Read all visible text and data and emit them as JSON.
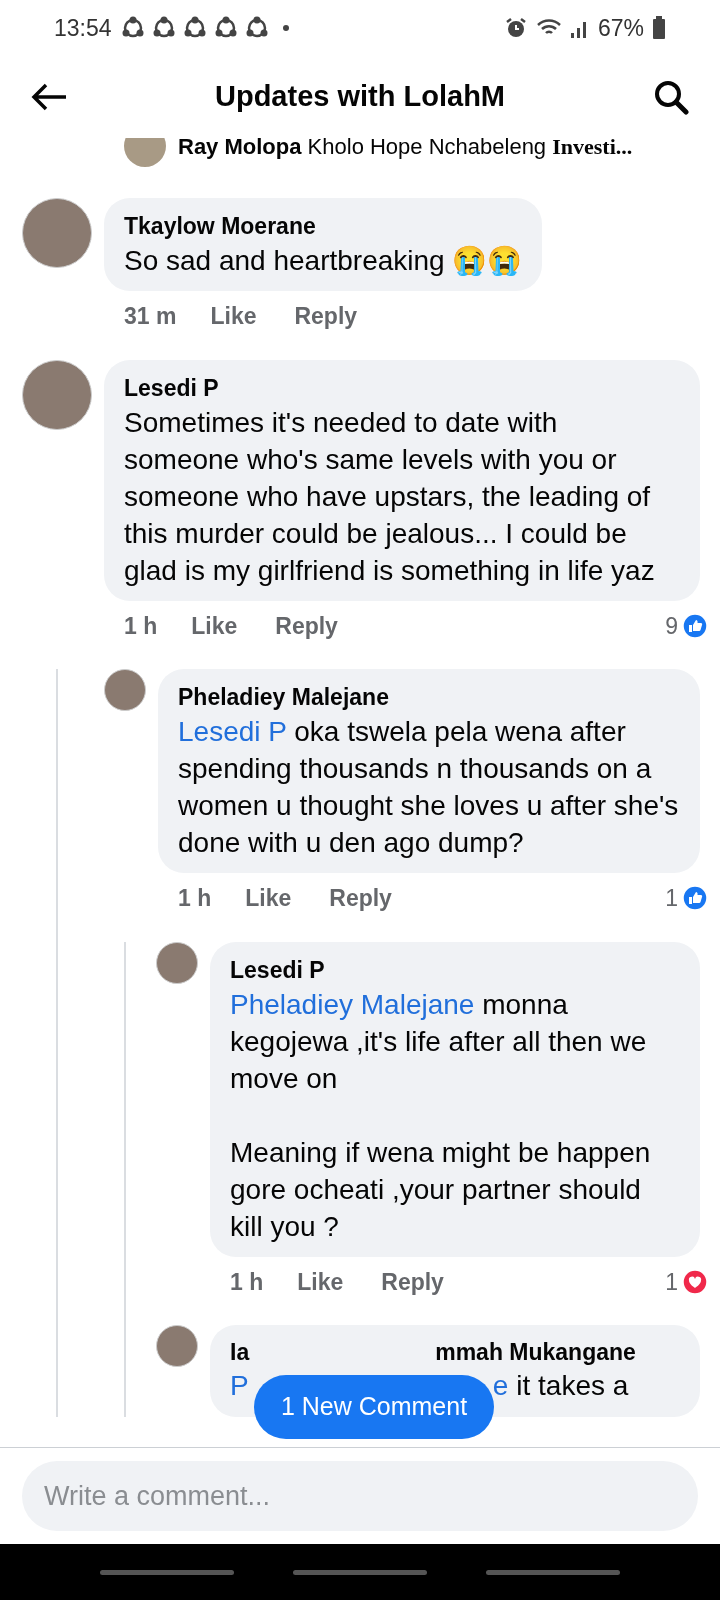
{
  "status_bar": {
    "time": "13:54",
    "battery": "67%"
  },
  "header": {
    "title": "Updates with LolahM"
  },
  "previous_reply": {
    "author": "Ray Molopa",
    "text": "Kholo Hope Nchabeleng",
    "tail": "Investi..."
  },
  "comments": [
    {
      "author": "Tkaylow Moerane",
      "text": "So sad and heartbreaking 😭😭",
      "time": "31 m",
      "actions": [
        "Like",
        "Reply"
      ]
    },
    {
      "author": "Lesedi P",
      "text": "Sometimes it's needed to date with someone who's same levels with you or someone who have upstars, the leading of this murder could be jealous... I could be glad is my girlfriend is something in life yaz",
      "time": "1 h",
      "actions": [
        "Like",
        "Reply"
      ],
      "reaction": {
        "count": "9",
        "kind": "like"
      },
      "children": [
        {
          "author": "Pheladiey Malejane",
          "mention": "Lesedi P",
          "text": "oka tswela pela wena after spending thousands n thousands on a women u thought she loves u after she's done with u den ago dump?",
          "time": "1 h",
          "actions": [
            "Like",
            "Reply"
          ],
          "reaction": {
            "count": "1",
            "kind": "like"
          },
          "children": [
            {
              "author": "Lesedi P",
              "mention": "Pheladiey Malejane",
              "text": "monna kegojewa ,it's life after all then we move on\n\nMeaning if wena might be happen gore ocheati ,your partner should kill you ?",
              "time": "1 h",
              "actions": [
                "Like",
                "Reply"
              ],
              "reaction": {
                "count": "1",
                "kind": "love"
              }
            },
            {
              "author_start": "Ia",
              "author_end": "mmah Mukangane",
              "mention_start": "P",
              "mention_end": "e",
              "text": "it takes a"
            }
          ]
        }
      ]
    }
  ],
  "new_comment_button": "1 New Comment",
  "comment_field": {
    "placeholder": "Write a comment..."
  }
}
